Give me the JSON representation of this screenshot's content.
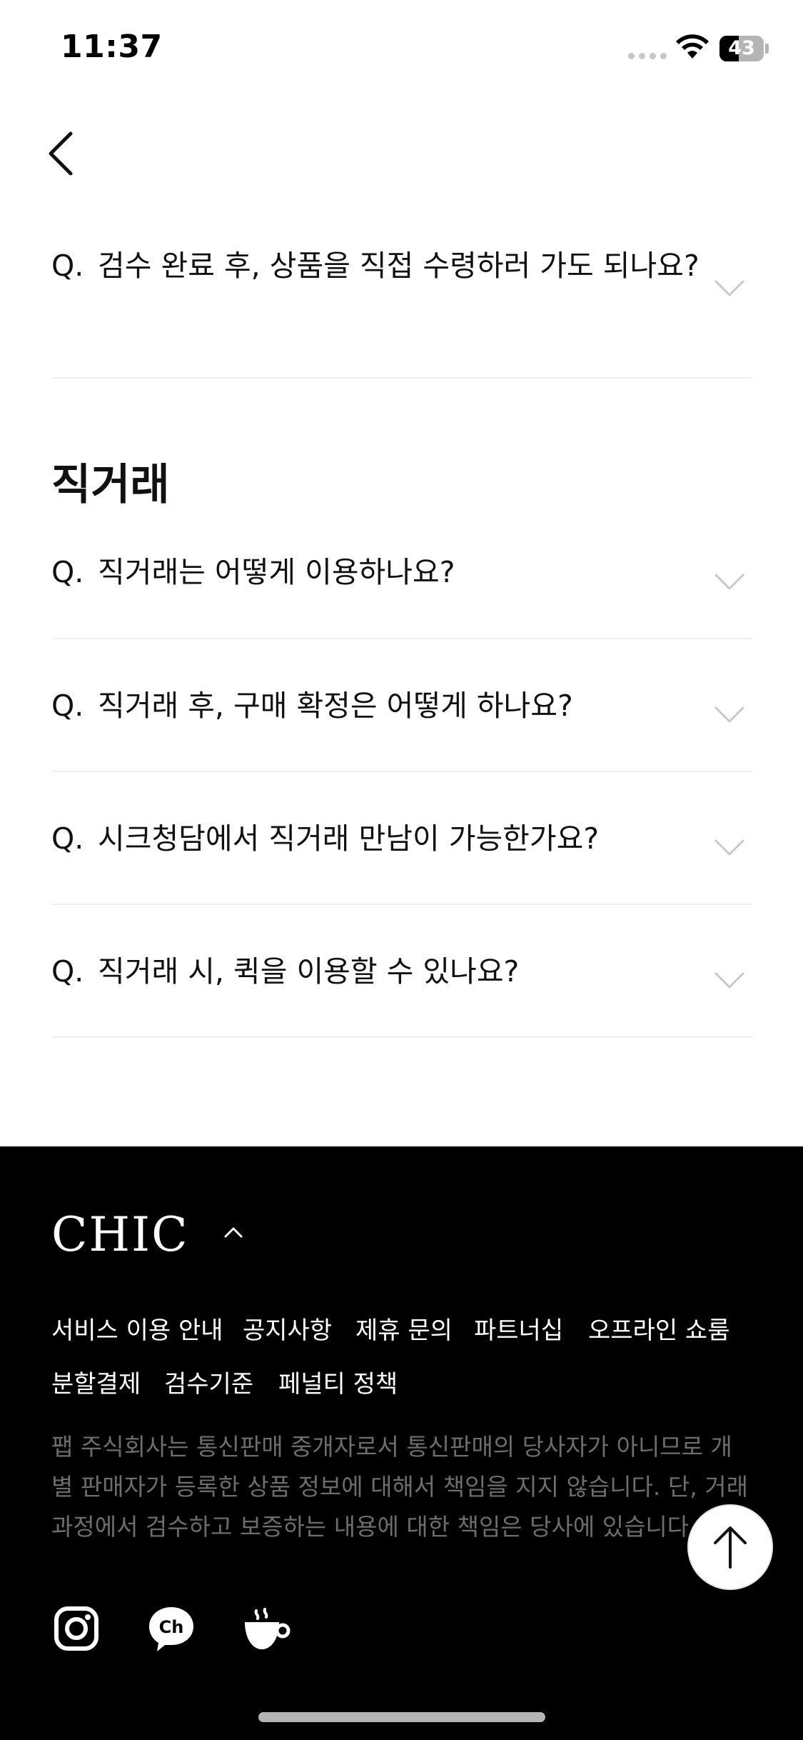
{
  "status_bar": {
    "time": "11:37",
    "battery": "43",
    "battery_level": 0.43
  },
  "faq_top": [
    {
      "prefix": "Q.",
      "question": "검수 완료 후, 상품을 직접 수령하러 가도 되나요?"
    }
  ],
  "section": {
    "title": "직거래",
    "items": [
      {
        "prefix": "Q.",
        "question": "직거래는 어떻게 이용하나요?"
      },
      {
        "prefix": "Q.",
        "question": "직거래 후, 구매 확정은 어떻게 하나요?"
      },
      {
        "prefix": "Q.",
        "question": "시크청담에서 직거래 만남이 가능한가요?"
      },
      {
        "prefix": "Q.",
        "question": "직거래 시, 퀵을 이용할 수 있나요?"
      }
    ]
  },
  "footer": {
    "brand": "CHIC",
    "links": [
      "서비스 이용 안내",
      "공지사항",
      "제휴 문의",
      "파트너십",
      "오프라인 쇼룸",
      "분할결제",
      "검수기준",
      "페널티 정책"
    ],
    "disclaimer": "팹 주식회사는 통신판매 중개자로서 통신판매의 당사자가 아니므로 개별 판매자가 등록한 상품 정보에 대해서 책임을 지지 않습니다. 단, 거래 과정에서 검수하고 보증하는 내용에 대한 책임은 당사에 있습니다.",
    "social": [
      "instagram-icon",
      "kakao-channel-icon",
      "coffee-icon"
    ]
  }
}
